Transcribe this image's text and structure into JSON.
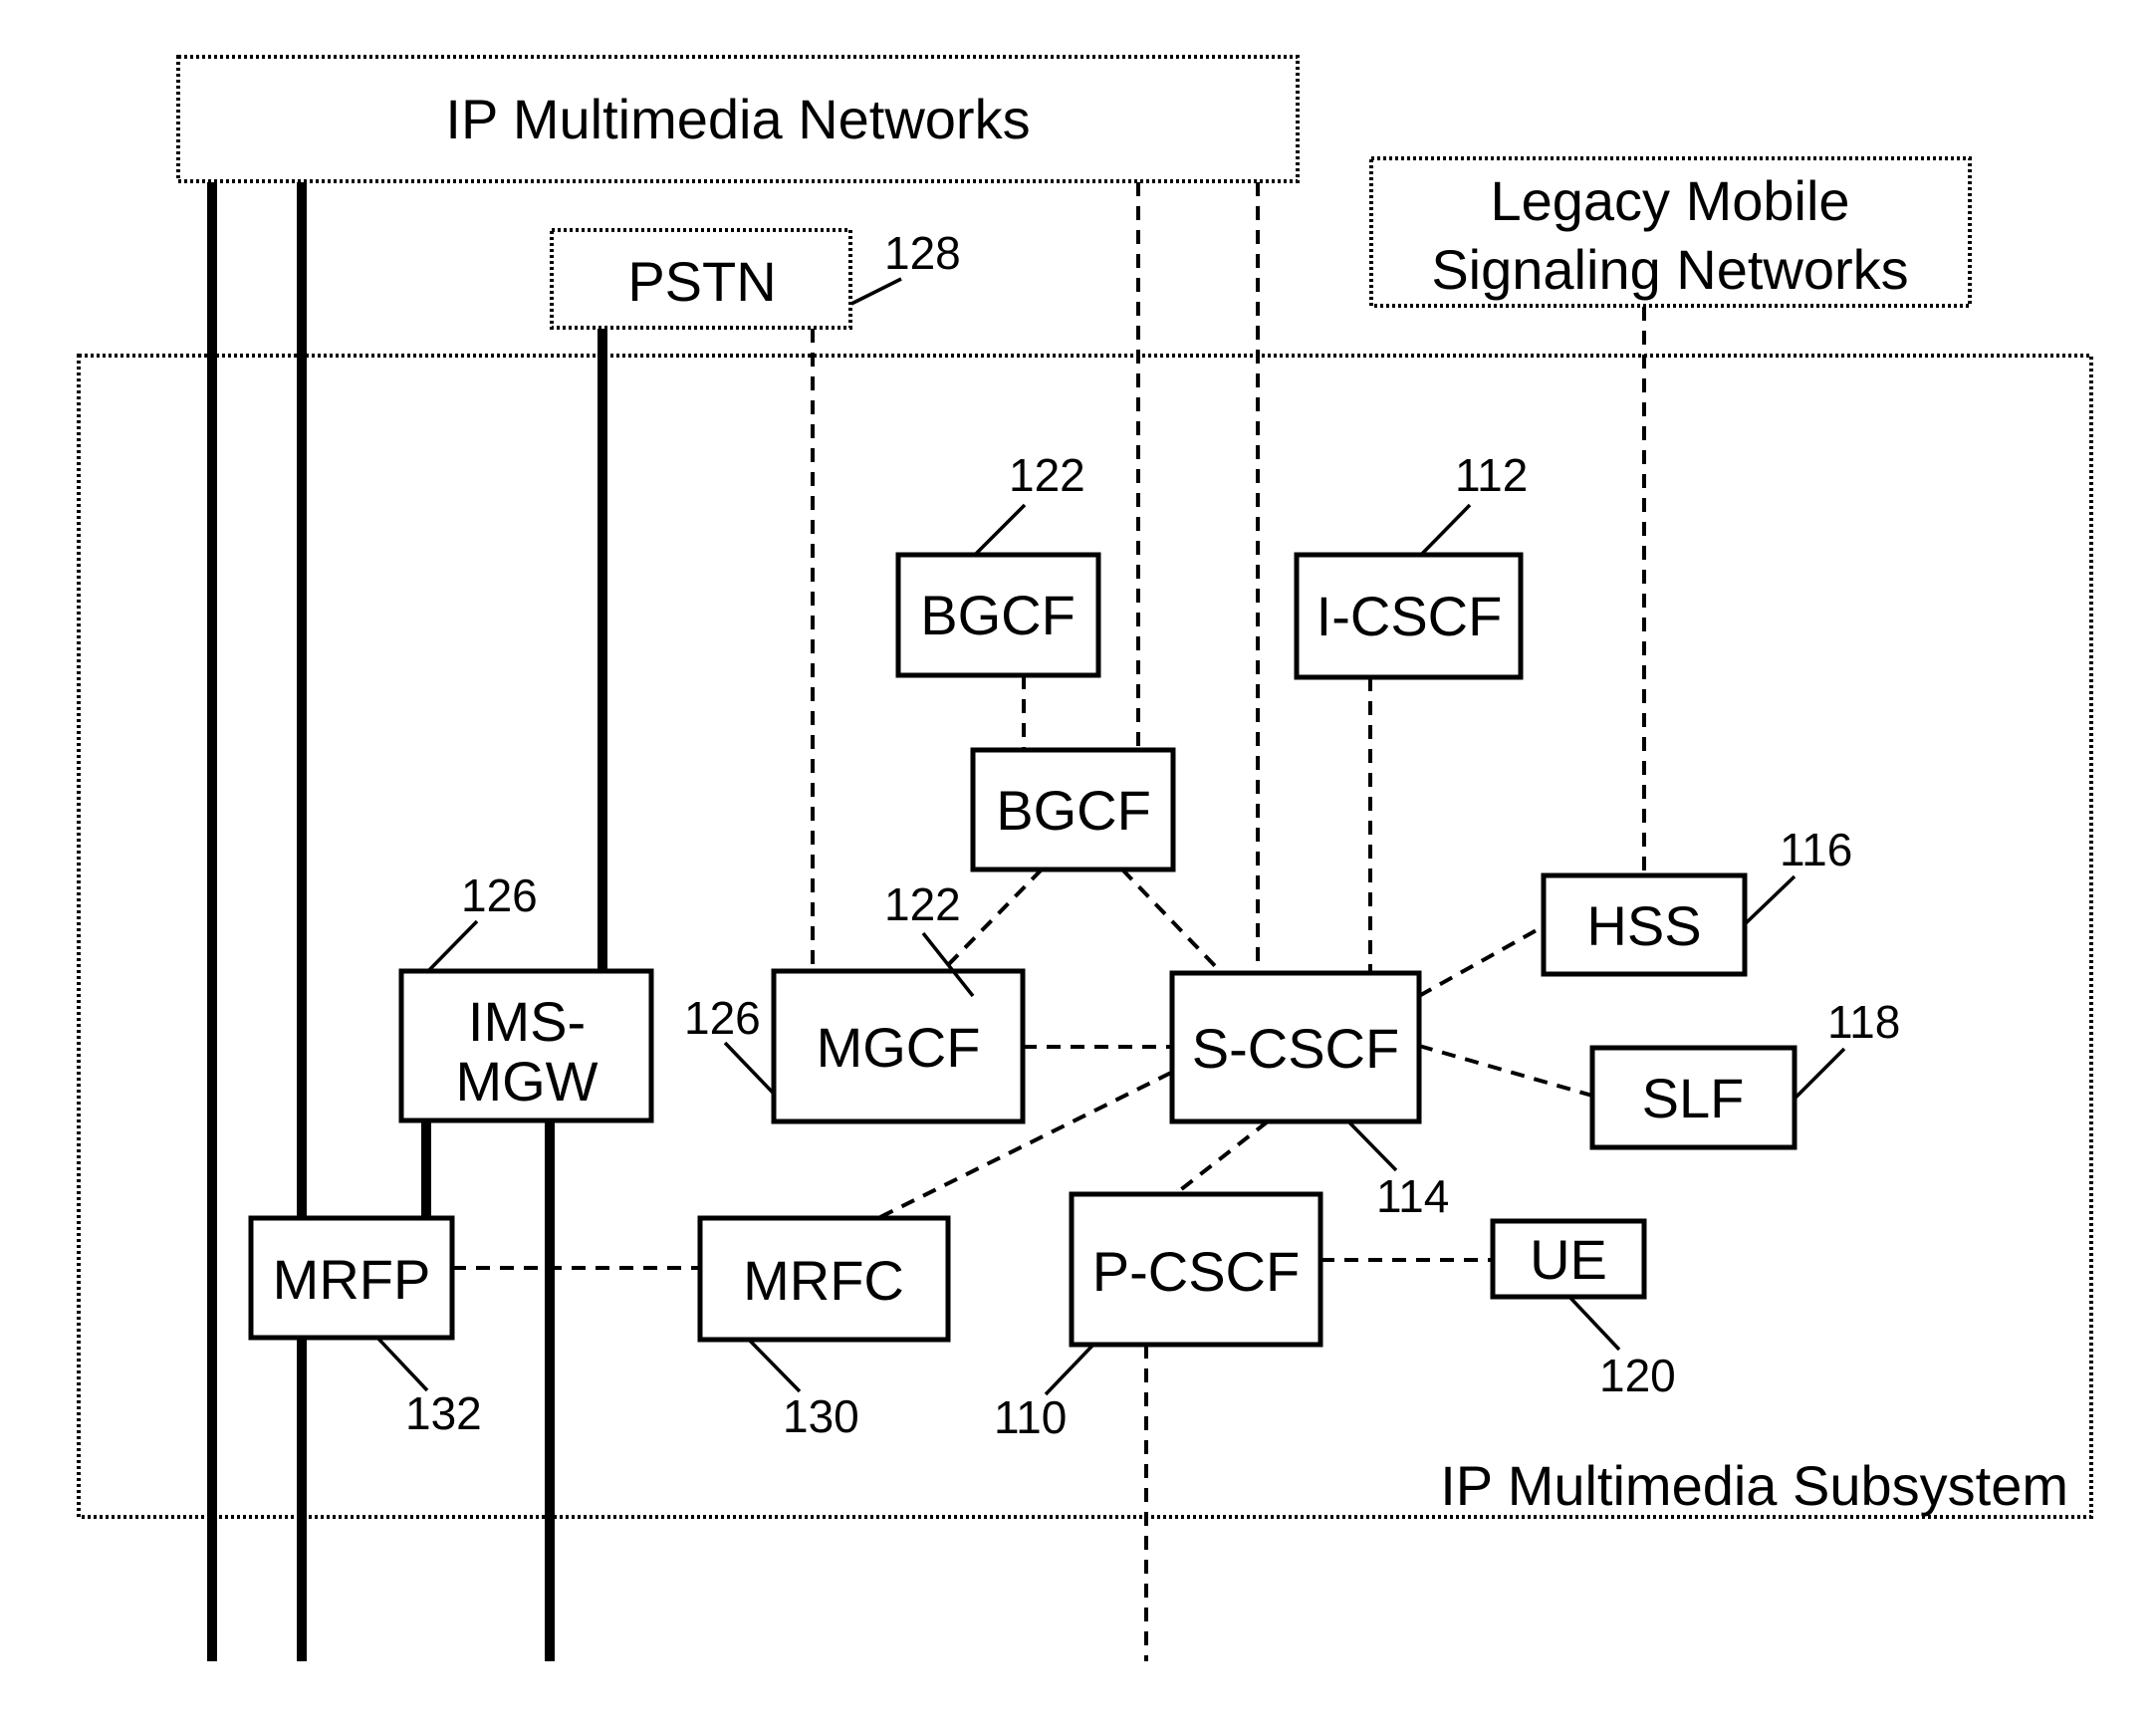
{
  "diagram": {
    "containers": {
      "ip_multimedia_networks": "IP Multimedia Networks",
      "legacy_line1": "Legacy Mobile",
      "legacy_line2": "Signaling Networks",
      "pstn": "PSTN",
      "ims": "IP Multimedia Subsystem"
    },
    "nodes": {
      "bgcf_top": "BGCF",
      "bgcf_mid": "BGCF",
      "icscf": "I-CSCF",
      "ims_mgw_line1": "IMS-",
      "ims_mgw_line2": "MGW",
      "mgcf": "MGCF",
      "scscf": "S-CSCF",
      "hss": "HSS",
      "slf": "SLF",
      "mrfp": "MRFP",
      "mrfc": "MRFC",
      "pcscf": "P-CSCF",
      "ue": "UE"
    },
    "refs": {
      "pstn": "128",
      "bgcf_top": "122",
      "bgcf_mid": "122",
      "icscf": "112",
      "ims_mgw": "126",
      "mgcf": "126",
      "hss": "116",
      "slf": "118",
      "scscf": "114",
      "mrfp": "132",
      "mrfc": "130",
      "pcscf": "110",
      "ue": "120"
    }
  }
}
